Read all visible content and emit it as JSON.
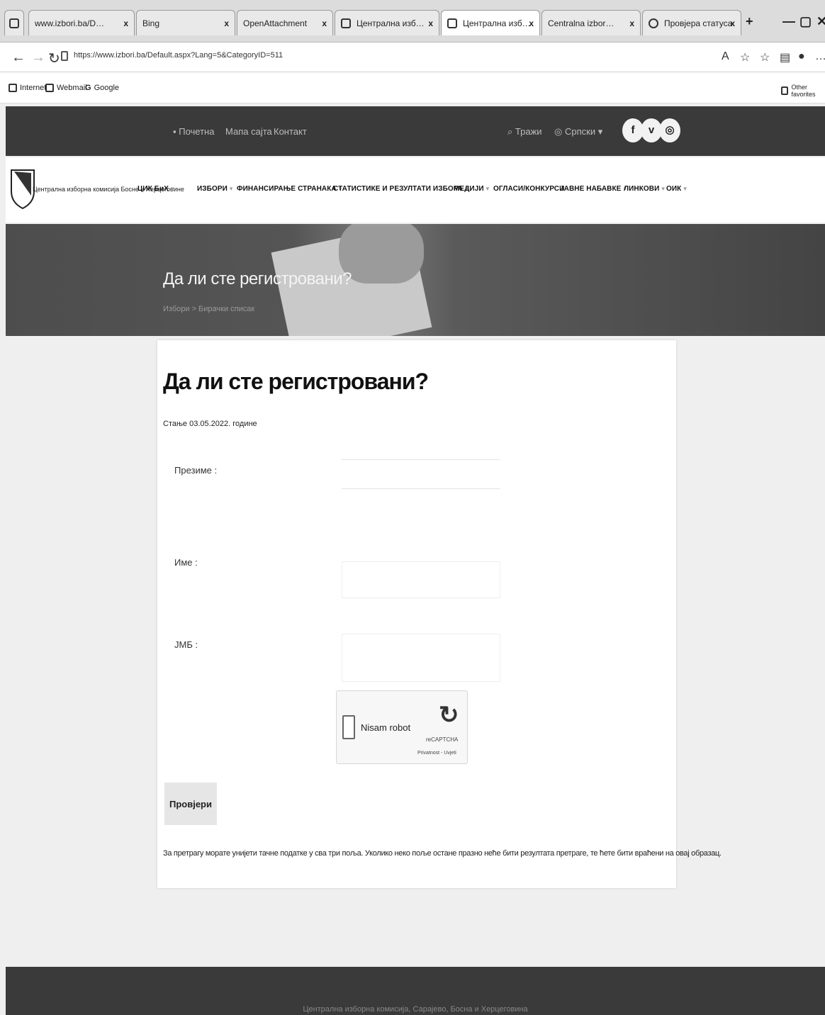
{
  "browser": {
    "tabs": [
      {
        "title": "www.izbori.ba/Default.aspx",
        "active": false
      },
      {
        "title": "Bing",
        "active": false
      },
      {
        "title": "OpenAttachment",
        "active": false
      },
      {
        "title": "Централна изборна комисија",
        "active": false
      },
      {
        "title": "Централна изборна комисија",
        "active": true
      },
      {
        "title": "Centralna izborna komisija",
        "active": false
      },
      {
        "title": "Провјера статуса",
        "active": false
      }
    ],
    "window_controls": [
      "—",
      "▢",
      "✕"
    ],
    "url": "https://www.izbori.ba/Default.aspx?Lang=5&CategoryID=511",
    "bookmarks": [
      "Internet",
      "Webmail",
      "Google"
    ],
    "other_favorites": "Other favorites"
  },
  "site": {
    "top_links": [
      "Почетна",
      "Мапа сајта",
      "Контакт"
    ],
    "search_label": "Тражи",
    "language_label": "Српски",
    "social": [
      "f",
      "v",
      "◎"
    ],
    "org_name": "Централна изборна комисија Босне и Херцеговине",
    "menu": [
      "ЦИК БиХ",
      "ИЗБОРИ",
      "ФИНАНСИРАЊЕ СТРАНАКА",
      "СТАТИСТИКЕ И РЕЗУЛТАТИ ИЗБОРА",
      "МЕДИЈИ",
      "ОГЛАСИ/КОНКУРСИ",
      "ЈАВНЕ НАБАВКЕ",
      "ЛИНКОВИ",
      "ОИК"
    ]
  },
  "hero": {
    "title": "Да ли сте регистровани?",
    "breadcrumb": "Избори > Бирачки списак"
  },
  "form": {
    "title": "Да ли сте регистровани?",
    "status": "Стање 03.05.2022. године",
    "surname_label": "Презиме :",
    "name_label": "Име :",
    "jmb_label": "ЈМБ :",
    "captcha_label": "Nisam robot",
    "captcha_brand": "reCAPTCHA",
    "captcha_terms": "Privatnost - Uvjeti",
    "submit_label": "Провјери",
    "note": "За претрагу морате унијети тачне податке у сва три поља. Уколико неко поље остане празно неће бити резултата претраге, те ћете бити враћени на овај образац."
  },
  "footer": {
    "text": "Централна изборна комисија, Сарајево, Босна и Херцеговина"
  }
}
